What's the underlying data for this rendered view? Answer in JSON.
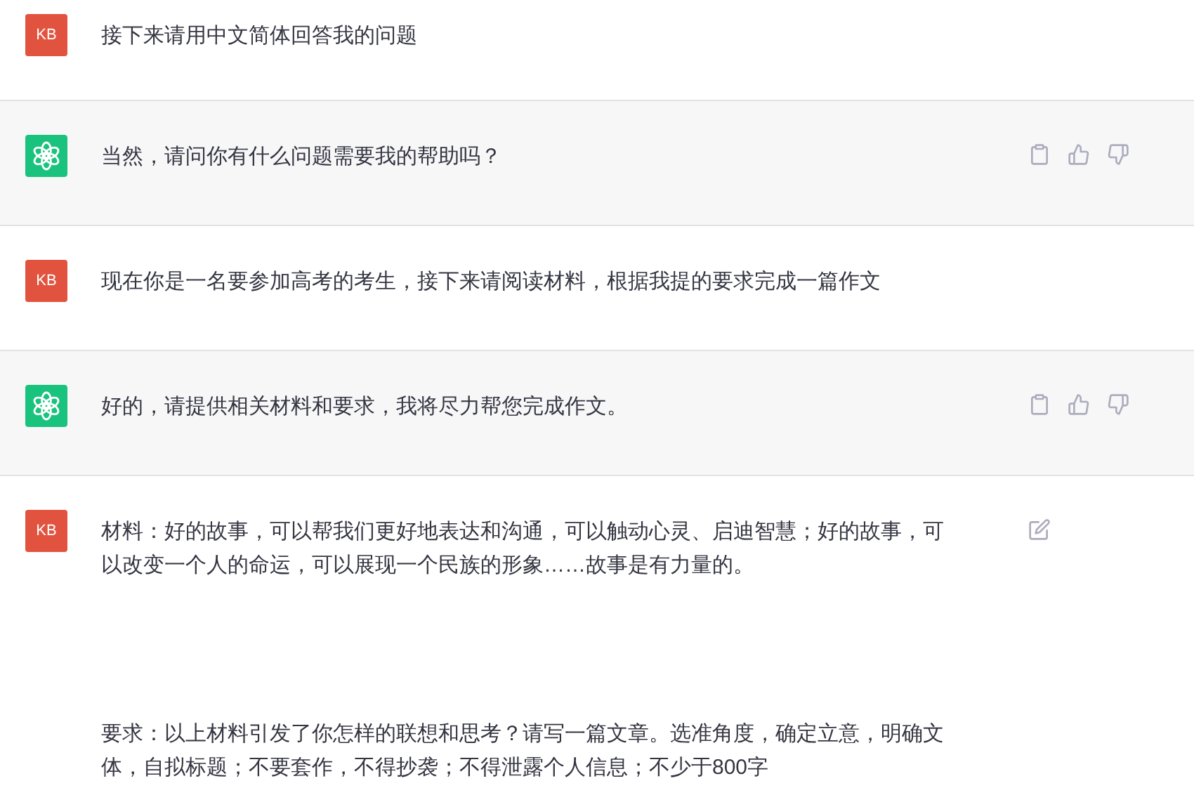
{
  "messages": [
    {
      "kind": "user",
      "avatar": "KB",
      "paragraphs": [
        "接下来请用中文简体回答我的问题"
      ],
      "show_edit": false
    },
    {
      "kind": "assistant",
      "paragraphs": [
        "当然，请问你有什么问题需要我的帮助吗？"
      ]
    },
    {
      "kind": "user",
      "avatar": "KB",
      "paragraphs": [
        "现在你是一名要参加高考的考生，接下来请阅读材料，根据我提的要求完成一篇作文"
      ],
      "show_edit": false
    },
    {
      "kind": "assistant",
      "paragraphs": [
        "好的，请提供相关材料和要求，我将尽力帮您完成作文。"
      ]
    },
    {
      "kind": "user",
      "avatar": "KB",
      "paragraphs": [
        "材料：好的故事，可以帮我们更好地表达和沟通，可以触动心灵、启迪智慧；好的故事，可以改变一个人的命运，可以展现一个民族的形象……故事是有力量的。",
        "要求：以上材料引发了你怎样的联想和思考？请写一篇文章。选准角度，确定立意，明确文体，自拟标题；不要套作，不得抄袭；不得泄露个人信息；不少于800字"
      ],
      "show_edit": true
    }
  ]
}
